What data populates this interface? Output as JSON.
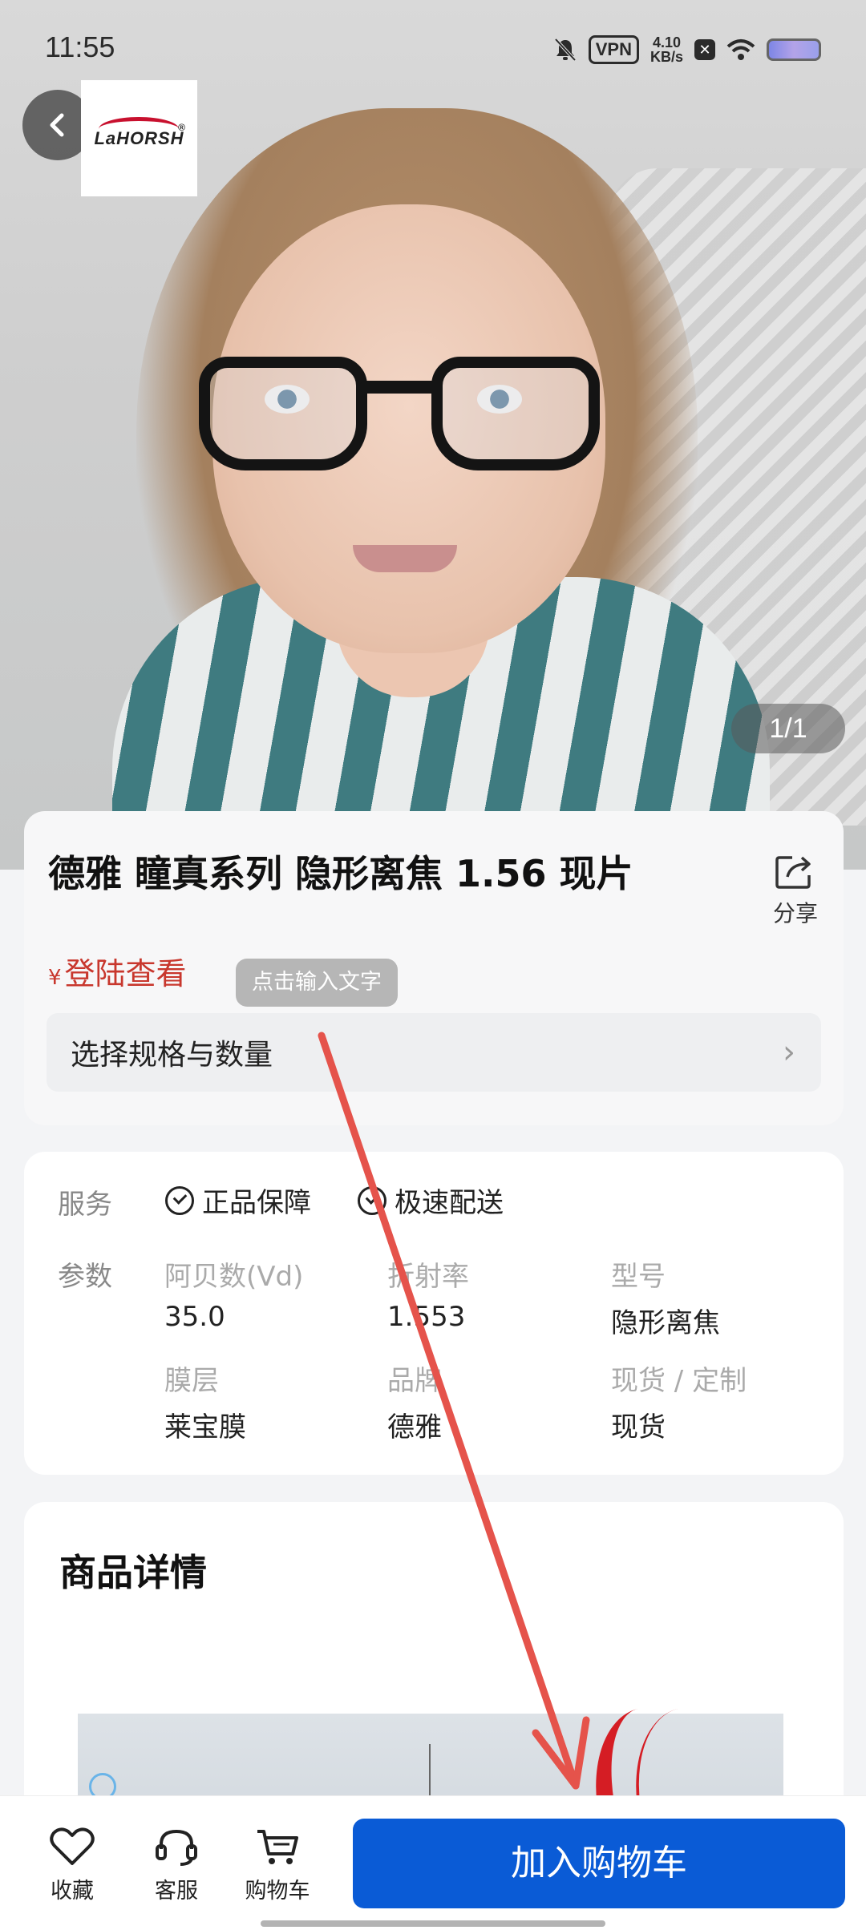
{
  "status_bar": {
    "time": "11:55",
    "vpn": "VPN",
    "speed_value": "4.10",
    "speed_unit": "KB/s"
  },
  "hero": {
    "logo_text": "LaHORSH",
    "pager": "1/1"
  },
  "product": {
    "title": "德雅 瞳真系列 隐形离焦 1.56 现片",
    "share_label": "分享",
    "price_symbol": "¥",
    "price_text": "登陆查看",
    "hint_chip": "点击输入文字",
    "spec_selector": "选择规格与数量"
  },
  "service": {
    "label": "服务",
    "items": [
      "正品保障",
      "极速配送"
    ]
  },
  "params": {
    "label": "参数",
    "rows": [
      [
        {
          "key": "阿贝数(Vd)",
          "value": "35.0"
        },
        {
          "key": "折射率",
          "value": "1.553"
        },
        {
          "key": "型号",
          "value": "隐形离焦"
        }
      ],
      [
        {
          "key": "膜层",
          "value": "莱宝膜"
        },
        {
          "key": "品牌",
          "value": "德雅"
        },
        {
          "key": "现货 / 定制",
          "value": "现货"
        }
      ]
    ]
  },
  "details": {
    "title": "商品详情"
  },
  "bottom_bar": {
    "favorite": "收藏",
    "service": "客服",
    "cart": "购物车",
    "add_to_cart": "加入购物车"
  },
  "colors": {
    "accent": "#0a5bd6",
    "price": "#c8372d",
    "annotation_arrow": "#e5534b"
  }
}
